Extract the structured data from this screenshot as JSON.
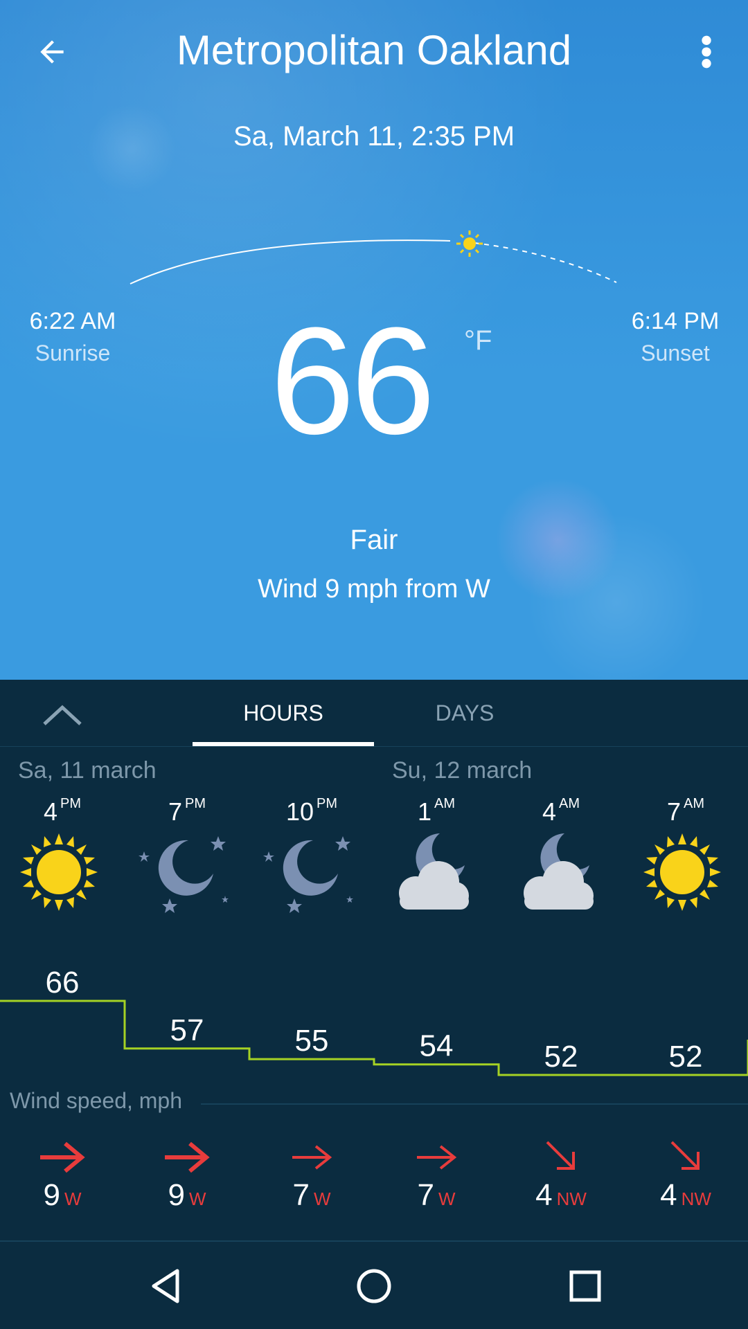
{
  "header": {
    "title": "Metropolitan Oakland",
    "back_icon": "arrow-left-icon",
    "menu_icon": "more-vertical-icon"
  },
  "current": {
    "datetime": "Sa, March 11, 2:35 PM",
    "sunrise_time": "6:22 AM",
    "sunrise_label": "Sunrise",
    "sunset_time": "6:14 PM",
    "sunset_label": "Sunset",
    "temperature": "66",
    "unit": "°F",
    "condition": "Fair",
    "wind": "Wind 9 mph from W"
  },
  "tabs": {
    "hours": "HOURS",
    "days": "DAYS",
    "selected": "hours"
  },
  "days": [
    "Sa, 11 march",
    "Su, 12 march"
  ],
  "hours": [
    {
      "hour": "4",
      "ampm": "PM",
      "icon": "sun",
      "temp": 66,
      "temp_label": "66",
      "wind": "9",
      "dir": "W",
      "arrow": "arrow-right-bold"
    },
    {
      "hour": "7",
      "ampm": "PM",
      "icon": "moon-stars",
      "temp": 57,
      "temp_label": "57",
      "wind": "9",
      "dir": "W",
      "arrow": "arrow-right-bold"
    },
    {
      "hour": "10",
      "ampm": "PM",
      "icon": "moon-stars",
      "temp": 55,
      "temp_label": "55",
      "wind": "7",
      "dir": "W",
      "arrow": "arrow-right"
    },
    {
      "hour": "1",
      "ampm": "AM",
      "icon": "moon-cloud",
      "temp": 54,
      "temp_label": "54",
      "wind": "7",
      "dir": "W",
      "arrow": "arrow-right"
    },
    {
      "hour": "4",
      "ampm": "AM",
      "icon": "moon-cloud",
      "temp": 52,
      "temp_label": "52",
      "wind": "4",
      "dir": "NW",
      "arrow": "arrow-down-right"
    },
    {
      "hour": "7",
      "ampm": "AM",
      "icon": "sun",
      "temp": 52,
      "temp_label": "52",
      "wind": "4",
      "dir": "NW",
      "arrow": "arrow-down-right"
    }
  ],
  "wind_section_title": "Wind speed, mph",
  "colors": {
    "accent_line": "#a6d224",
    "wind_arrow": "#e83c3c",
    "sun": "#f9d31a",
    "panel_bg": "#0b2c40"
  },
  "navbar": {
    "back": "nav-back-icon",
    "home": "nav-home-icon",
    "recents": "nav-recents-icon"
  }
}
